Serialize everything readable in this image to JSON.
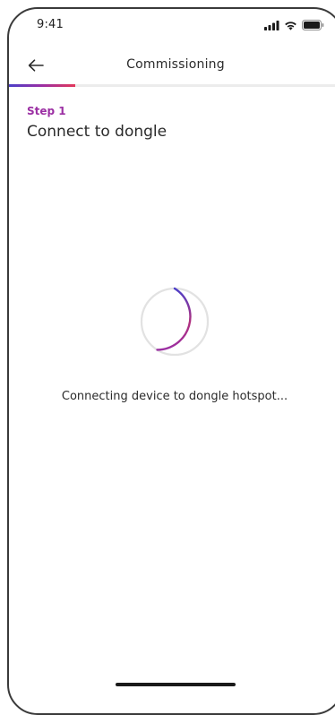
{
  "status_bar": {
    "time": "9:41",
    "icons": [
      "cellular-signal-icon",
      "wifi-icon",
      "battery-icon"
    ]
  },
  "header": {
    "back_icon": "arrow-left-icon",
    "title": "Commissioning"
  },
  "progress": {
    "fraction": 0.2,
    "gradient": [
      "#4b3fc9",
      "#9b2fa3",
      "#e2385a"
    ]
  },
  "step": {
    "label": "Step 1",
    "title": "Connect to dongle"
  },
  "loading": {
    "message": "Connecting device to dongle hotspot...",
    "spinner_colors": [
      "#4b3fc9",
      "#9b2fa3",
      "#e2385a"
    ]
  }
}
